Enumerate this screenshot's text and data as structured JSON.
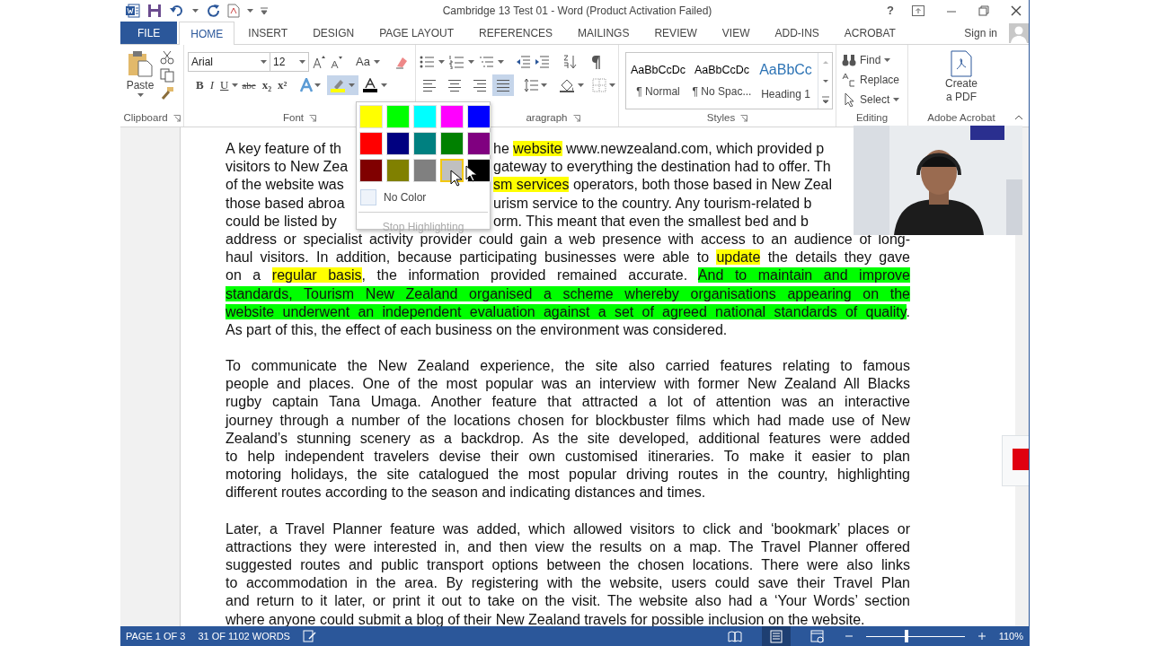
{
  "title_bar": {
    "title": "Cambridge 13 Test 01 - Word (Product Activation Failed)",
    "help": "?"
  },
  "tabs": [
    {
      "label": "FILE",
      "kind": "file",
      "selected": false
    },
    {
      "label": "HOME",
      "kind": "tab",
      "selected": true
    },
    {
      "label": "INSERT",
      "kind": "tab",
      "selected": false
    },
    {
      "label": "DESIGN",
      "kind": "tab",
      "selected": false
    },
    {
      "label": "PAGE LAYOUT",
      "kind": "tab",
      "selected": false
    },
    {
      "label": "REFERENCES",
      "kind": "tab",
      "selected": false
    },
    {
      "label": "MAILINGS",
      "kind": "tab",
      "selected": false
    },
    {
      "label": "REVIEW",
      "kind": "tab",
      "selected": false
    },
    {
      "label": "VIEW",
      "kind": "tab",
      "selected": false
    },
    {
      "label": "ADD-INS",
      "kind": "tab",
      "selected": false
    },
    {
      "label": "ACROBAT",
      "kind": "tab",
      "selected": false
    }
  ],
  "sign_in": "Sign in",
  "ribbon": {
    "clipboard": {
      "paste": "Paste",
      "label": "Clipboard"
    },
    "font": {
      "font_name": "Arial",
      "font_size": "12",
      "change_case": "Aa",
      "label": "Font",
      "format_buttons": [
        {
          "label": "B",
          "kind": "bold"
        },
        {
          "label": "I",
          "kind": "italic"
        },
        {
          "label": "U",
          "kind": "underline"
        },
        {
          "label": "abc",
          "kind": "strike"
        },
        {
          "label": "x₂",
          "kind": "sub"
        },
        {
          "label": "x²",
          "kind": "sup"
        }
      ],
      "highlight_button": {
        "expanded": true
      }
    },
    "paragraph": {
      "label": "aragraph",
      "alignments": [
        {
          "kind": "left",
          "selected": false
        },
        {
          "kind": "center",
          "selected": false
        },
        {
          "kind": "right",
          "selected": false
        },
        {
          "kind": "justify",
          "selected": true
        }
      ]
    },
    "styles": {
      "label": "Styles",
      "items": [
        {
          "preview": "AaBbCcDc",
          "name": "¶ Normal",
          "kind": "body"
        },
        {
          "preview": "AaBbCcDc",
          "name": "¶ No Spac...",
          "kind": "body"
        },
        {
          "preview": "AaBbCc",
          "name": "Heading 1",
          "kind": "heading"
        }
      ]
    },
    "editing": {
      "label": "Editing",
      "find": "Find",
      "replace": "Replace",
      "select": "Select"
    },
    "acrobat": {
      "label": "Adobe Acrobat",
      "create_lines": [
        "Create",
        "a PDF"
      ]
    }
  },
  "highlight_menu": {
    "colors": [
      {
        "color": "#ffff00",
        "hovered": false
      },
      {
        "color": "#00ff00",
        "hovered": false
      },
      {
        "color": "#00ffff",
        "hovered": false
      },
      {
        "color": "#ff00ff",
        "hovered": false
      },
      {
        "color": "#0000ff",
        "hovered": false
      },
      {
        "color": "#ff0000",
        "hovered": false
      },
      {
        "color": "#000080",
        "hovered": false
      },
      {
        "color": "#008080",
        "hovered": false
      },
      {
        "color": "#008000",
        "hovered": false
      },
      {
        "color": "#800080",
        "hovered": false
      },
      {
        "color": "#800000",
        "hovered": false
      },
      {
        "color": "#808000",
        "hovered": false
      },
      {
        "color": "#808080",
        "hovered": false
      },
      {
        "color": "#c0c0c0",
        "hovered": true
      },
      {
        "color": "#000000",
        "hovered": false
      }
    ],
    "no_color": "No Color",
    "stop": {
      "label": "Stop Highlighting",
      "disabled": true
    }
  },
  "document": {
    "paragraphs": [
      {
        "lines": [
          {
            "kind": "split",
            "left": [
              {
                "text": "A key feature of th"
              }
            ],
            "right": [
              {
                "text": "he "
              },
              {
                "text": "website",
                "color": "#ffff00"
              },
              {
                "text": " www.newzealand.com, which provided p"
              }
            ]
          },
          {
            "kind": "split",
            "left": [
              {
                "text": "visitors to New Zea"
              }
            ],
            "right": [
              {
                "text": "gateway to everything the destination had to offer. Th"
              }
            ]
          },
          {
            "kind": "split",
            "left": [
              {
                "text": "of the website was"
              }
            ],
            "right": [
              {
                "text": "sm services",
                "color": "#ffff00"
              },
              {
                "text": " operators, both those based in New Zeal"
              }
            ]
          },
          {
            "kind": "split",
            "left": [
              {
                "text": "those based abroa"
              }
            ],
            "right": [
              {
                "text": "urism service to the country. Any tourism-related b"
              }
            ]
          },
          {
            "kind": "split",
            "left": [
              {
                "text": "could be listed by"
              }
            ],
            "right": [
              {
                "text": "orm. This meant that even the smallest bed and b"
              }
            ]
          },
          {
            "kind": "full",
            "segments": [
              {
                "text": "address or specialist activity provider could gain a web presence with access to an audience of long-"
              }
            ]
          },
          {
            "kind": "full",
            "segments": [
              {
                "text": "haul visitors. In addition, because participating businesses were able to "
              },
              {
                "text": "update",
                "color": "#ffff00"
              },
              {
                "text": " the details they gave"
              }
            ]
          },
          {
            "kind": "full",
            "segments": [
              {
                "text": "on a "
              },
              {
                "text": "regular basis",
                "color": "#ffff00"
              },
              {
                "text": ", the information provided remained accurate. "
              },
              {
                "text": "And to maintain and improve",
                "color": "#00ff00"
              }
            ]
          },
          {
            "kind": "full",
            "segments": [
              {
                "text": "standards, Tourism New Zealand organised a scheme whereby organisations appearing on the",
                "color": "#00ff00"
              }
            ]
          },
          {
            "kind": "full",
            "segments": [
              {
                "text": "website underwent an independent evaluation against a set of agreed national standards of quality",
                "color": "#00ff00"
              },
              {
                "text": "."
              }
            ]
          },
          {
            "kind": "last",
            "segments": [
              {
                "text": "As part of this, the effect of each business on the environment was considered."
              }
            ]
          }
        ]
      },
      {
        "lines": [
          {
            "kind": "full",
            "segments": [
              {
                "text": "To communicate the New Zealand experience, the site also carried features relating to famous"
              }
            ]
          },
          {
            "kind": "full",
            "segments": [
              {
                "text": "people and places. One of the most popular was an interview with former New Zealand All Blacks"
              }
            ]
          },
          {
            "kind": "full",
            "segments": [
              {
                "text": "rugby captain Tana Umaga. Another feature that attracted a lot of attention was an interactive"
              }
            ]
          },
          {
            "kind": "full",
            "segments": [
              {
                "text": "journey through a number of the locations chosen for blockbuster films which had made use of New"
              }
            ]
          },
          {
            "kind": "full",
            "segments": [
              {
                "text": "Zealand’s stunning scenery as a backdrop. As the site developed, additional features were added"
              }
            ]
          },
          {
            "kind": "full",
            "segments": [
              {
                "text": "to help independent travelers devise their own customised itineraries. To make it easier to plan"
              }
            ]
          },
          {
            "kind": "full",
            "segments": [
              {
                "text": "motoring holidays, the site catalogued the most popular driving routes in the country, highlighting"
              }
            ]
          },
          {
            "kind": "last",
            "segments": [
              {
                "text": "different routes according to the season and indicating distances and times."
              }
            ]
          }
        ]
      },
      {
        "lines": [
          {
            "kind": "full",
            "segments": [
              {
                "text": "Later, a Travel Planner feature was added, which allowed visitors to click and ‘bookmark’ places or"
              }
            ]
          },
          {
            "kind": "full",
            "segments": [
              {
                "text": "attractions they were interested in, and then view the results on a map. The Travel Planner offered"
              }
            ]
          },
          {
            "kind": "full",
            "segments": [
              {
                "text": "suggested routes and public transport options between the chosen locations. There were also links"
              }
            ]
          },
          {
            "kind": "full",
            "segments": [
              {
                "text": "to accommodation in the area. By registering with the website, users could save their Travel Plan"
              }
            ]
          },
          {
            "kind": "full",
            "segments": [
              {
                "text": "and return to it later, or print it out to take on the visit. The website also had a ‘Your Words’ section"
              }
            ]
          },
          {
            "kind": "last",
            "segments": [
              {
                "text": "where anyone could submit a blog of their New Zealand travels for possible inclusion on the website."
              }
            ]
          }
        ]
      }
    ]
  },
  "status_bar": {
    "page": "PAGE 1 OF 3",
    "words": "31 OF 1102 WORDS",
    "views": [
      {
        "kind": "read",
        "selected": false
      },
      {
        "kind": "print",
        "selected": true
      },
      {
        "kind": "web",
        "selected": false
      }
    ],
    "zoom": {
      "level": 0.41,
      "reading": "110%"
    }
  }
}
